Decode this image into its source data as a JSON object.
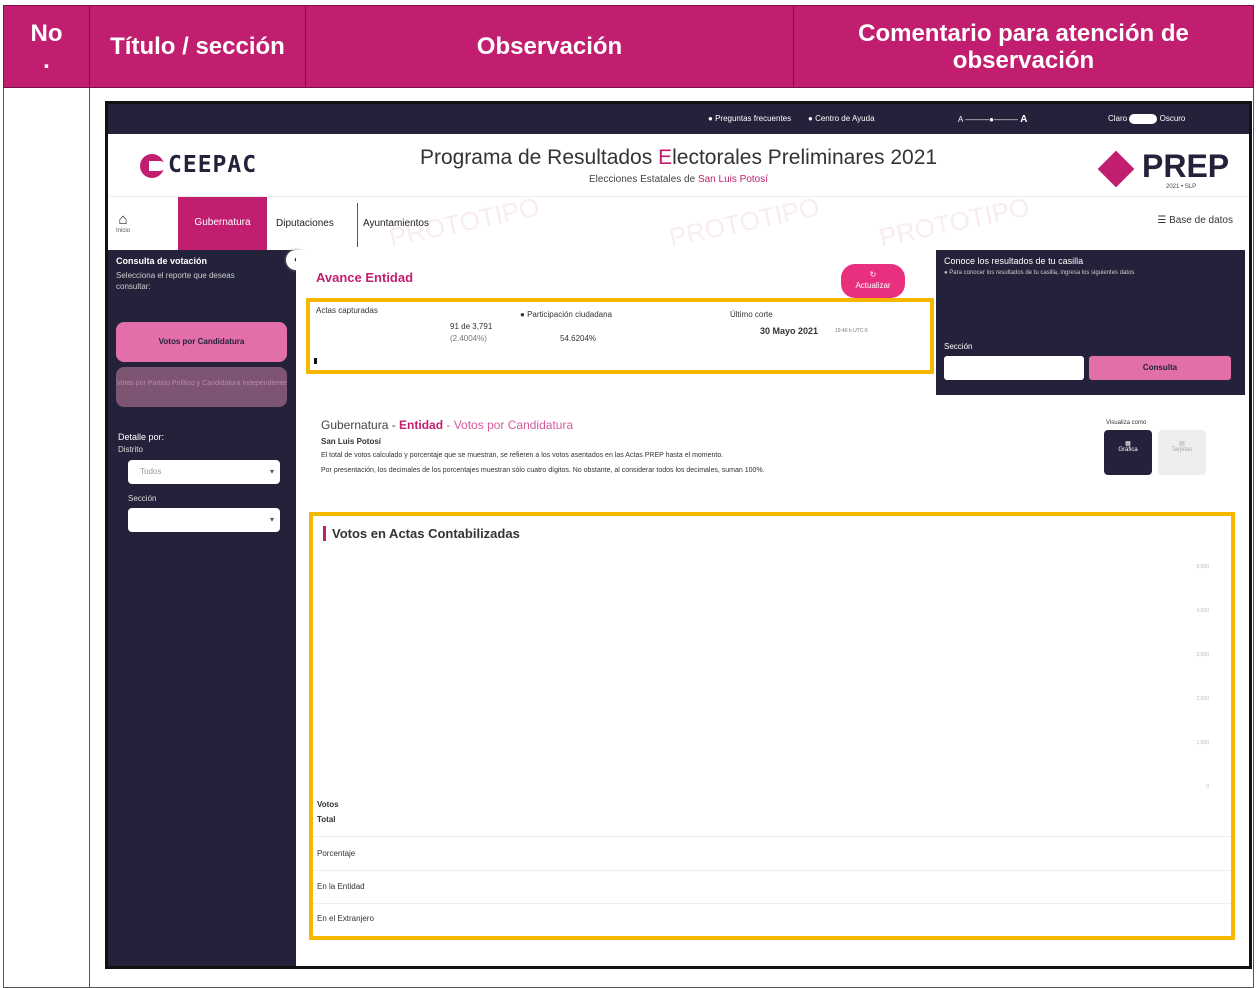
{
  "table": {
    "headers": [
      "No\n.",
      "Título / sección",
      "Observación",
      "Comentario para atención de observación"
    ]
  },
  "screenshot": {
    "topbar": {
      "faq": "Preguntas frecuentes",
      "help": "Centro de Ayuda",
      "font_small": "A",
      "font_big": "A",
      "theme_light": "Claro",
      "theme_dark": "Oscuro"
    },
    "header": {
      "logo": "CEEPAC",
      "title_pre": "Programa de Resultados ",
      "title_e": "E",
      "title_post": "lectorales Preliminares 2021",
      "subtitle_pre": "Elecciones Estatales de ",
      "subtitle_place": "San Luis Potosí",
      "prep_logo": "PREP",
      "prep_sub": "2021 • SLP"
    },
    "nav": {
      "home": "Inicio",
      "tabs": [
        "Gubernatura",
        "Diputaciones",
        "Ayuntamientos"
      ],
      "database": "Base de datos",
      "watermark": "PROTOTIPO"
    },
    "sidebar": {
      "title": "Consulta de votación",
      "desc": "Selecciona el reporte que deseas consultar:",
      "btn_active": "Votos por Candidatura",
      "btn_inactive": "Votos por Partido Político y Candidatura Independiente",
      "detail": "Detalle por:",
      "distrito": "Distrito",
      "distrito_value": "Todos",
      "seccion": "Sección"
    },
    "main": {
      "avance": "Avance Entidad",
      "update": "Actualizar",
      "actas_label": "Actas capturadas",
      "actas_value": "91 de 3,791",
      "actas_pct": "(2.4004%)",
      "participacion_label": "Participación ciudadana",
      "participacion_value": "54.6204%",
      "corte_label": "Último corte",
      "corte_value": "30 Mayo 2021",
      "corte_time": "19:40 h UTC-5",
      "section_prefix": "Gubernatura - ",
      "section_entity": "Entidad",
      "section_suffix": " - Votos por Candidatura",
      "place": "San Luis Potosí",
      "note1": "El total de votos calculado y porcentaje que se muestran, se refieren a los votos asentados en las Actas PREP hasta el momento.",
      "note2": "Por presentación, los decimales de los porcentajes muestran sólo cuatro dígitos. No obstante, al considerar todos los decimales, suman 100%.",
      "visualiza": "Visualiza como",
      "view_chart": "Gráfica",
      "view_table": "Tarjetas",
      "chart_title": "Votos en Actas Contabilizadas",
      "y_ticks": [
        "5,000",
        "4,000",
        "3,000",
        "2,000",
        "1,000",
        "0"
      ],
      "rows": [
        "Votos",
        "Total",
        "Porcentaje",
        "En la Entidad",
        "En el Extranjero"
      ]
    },
    "consulta": {
      "title": "Conoce los resultados de tu casilla",
      "desc": "Para conocer los resultados de tu casilla, ingresa los siguientes datos",
      "seccion": "Sección",
      "button": "Consulta"
    }
  }
}
